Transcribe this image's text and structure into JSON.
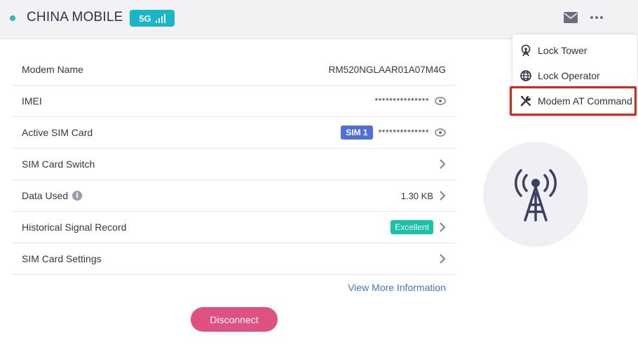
{
  "header": {
    "carrier": "CHINA MOBILE",
    "network_type": "5G",
    "signal_bars_level": 4,
    "status_color": "#22c1b1",
    "mail_icon": "mail-icon",
    "more_icon": "more-dots-icon"
  },
  "info": {
    "modem_name_label": "Modem Name",
    "modem_name_value": "RM520NGLAAR01A07M4G",
    "imei_label": "IMEI",
    "imei_value": "***************",
    "active_sim_label": "Active SIM Card",
    "active_sim_badge": "SIM 1",
    "active_sim_value": "**************",
    "sim_switch_label": "SIM Card Switch",
    "data_used_label": "Data Used",
    "data_used_value": "1.30 KB",
    "signal_record_label": "Historical Signal Record",
    "signal_record_badge": "Excellent",
    "sim_settings_label": "SIM Card Settings"
  },
  "actions": {
    "view_more": "View More Information",
    "disconnect": "Disconnect"
  },
  "menu": {
    "items": [
      {
        "label": "Lock Tower",
        "icon": "tower-pin-icon"
      },
      {
        "label": "Lock Operator",
        "icon": "globe-icon"
      },
      {
        "label": "Modem AT Command",
        "icon": "tools-icon",
        "highlighted": true
      }
    ]
  },
  "colors": {
    "accent_teal": "#17b7c9",
    "sim_badge": "#4f6fe0",
    "excellent": "#17c2a6",
    "disconnect": "#e05081",
    "link": "#4a72c8",
    "highlight_box": "#e3231b",
    "tower_icon": "#3d3f63"
  }
}
